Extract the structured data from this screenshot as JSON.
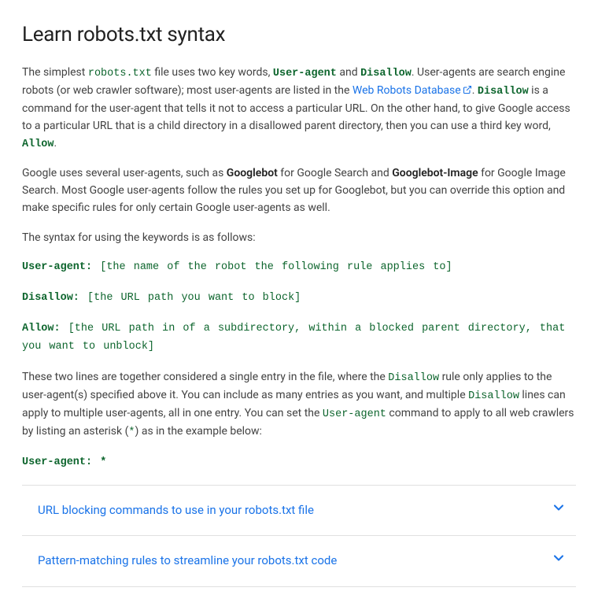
{
  "title": "Learn robots.txt syntax",
  "p1": {
    "t1": "The simplest ",
    "c1": "robots.txt",
    "t2": " file uses two key words, ",
    "c2": "User-agent",
    "t3": " and ",
    "c3": "Disallow",
    "t4": ". User-agents are search engine robots (or web crawler software); most user-agents are listed in the ",
    "link": "Web Robots Database",
    "t5": ". ",
    "c4": "Disallow",
    "t6": " is a command for the user-agent that tells it not to access a particular URL. On the other hand, to give Google access to a particular URL that is a child directory in a disallowed parent directory, then you can use a third key word, ",
    "c5": "Allow",
    "t7": "."
  },
  "p2": {
    "t1": "Google uses several user-agents, such as ",
    "b1": "Googlebot",
    "t2": " for Google Search and ",
    "b2": "Googlebot-Image",
    "t3": " for Google Image Search. Most Google user-agents follow the rules you set up for Googlebot, but you can override this option and make specific rules for only certain Google user-agents as well."
  },
  "p3": "The syntax for using the keywords is as follows:",
  "syntax1": {
    "kw": "User-agent:",
    "rest": " [the name of the robot the following rule applies to]"
  },
  "syntax2": {
    "kw": "Disallow:",
    "rest": " [the URL path you want to block]"
  },
  "syntax3": {
    "kw": "Allow:",
    "rest": " [the URL path in of a subdirectory, within a blocked parent directory, that you want to unblock]"
  },
  "p4": {
    "t1": "These two lines are together considered a single entry in the file, where the ",
    "c1": "Disallow",
    "t2": " rule only applies to the user-agent(s) specified above it. You can include as many entries as you want, and multiple ",
    "c2": "Disallow",
    "t3": " lines can apply to multiple user-agents, all in one entry. You can set the ",
    "c3": "User-agent",
    "t4": " command to apply to all web crawlers by listing an asterisk (",
    "c4": "*",
    "t5": ") as in the example below:"
  },
  "syntax4": "User-agent: *",
  "accordion": {
    "item1": "URL blocking commands to use in your robots.txt file",
    "item2": "Pattern-matching rules to streamline your robots.txt code"
  }
}
